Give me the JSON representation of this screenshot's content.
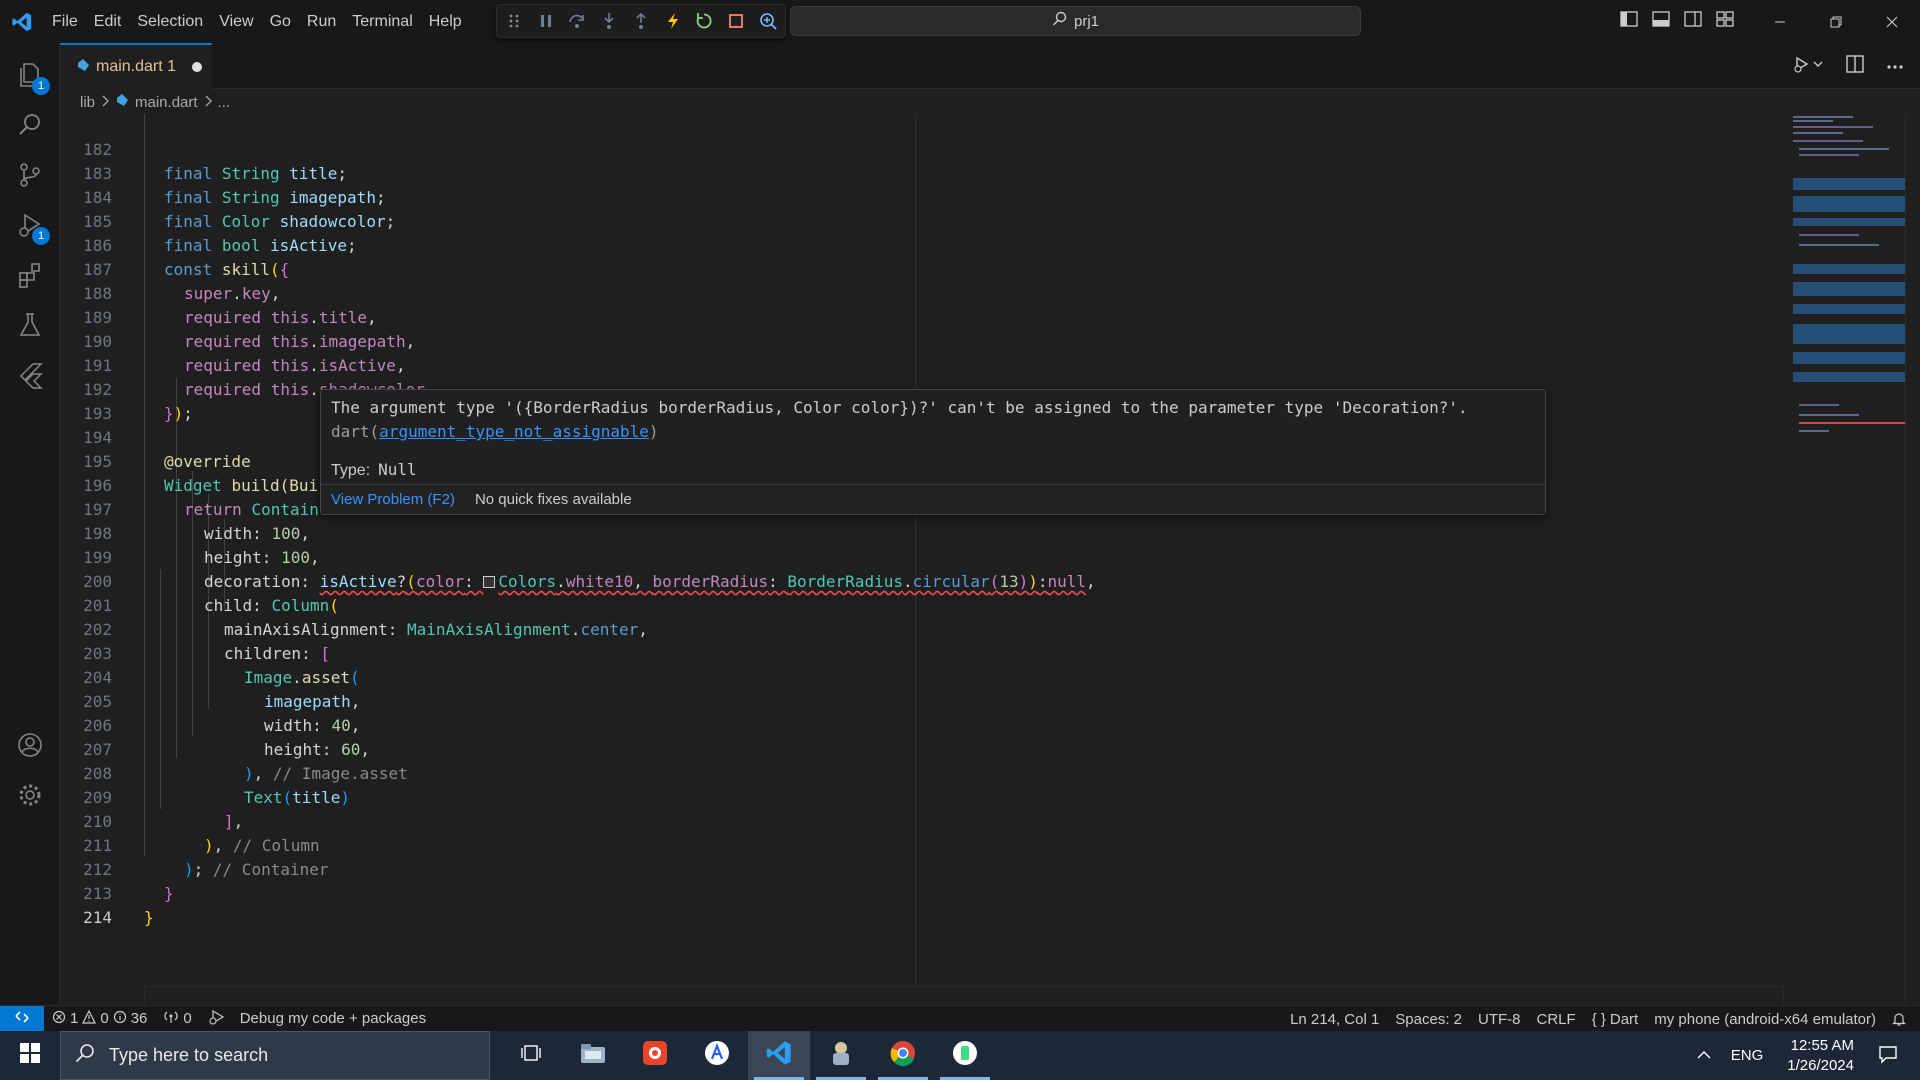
{
  "titlebar": {
    "menu": [
      "File",
      "Edit",
      "Selection",
      "View",
      "Go",
      "Run",
      "Terminal",
      "Help"
    ],
    "command_center": "prj1"
  },
  "activity_bar": {
    "explorer_badge": "1",
    "run_debug_badge": "1"
  },
  "tab": {
    "label": "main.dart 1"
  },
  "breadcrumb": {
    "folder": "lib",
    "file": "main.dart",
    "more": "..."
  },
  "editor": {
    "active_line": "214",
    "lines": [
      {
        "n": "182"
      },
      {
        "n": "183"
      },
      {
        "n": "184"
      },
      {
        "n": "185"
      },
      {
        "n": "186"
      },
      {
        "n": "187"
      },
      {
        "n": "188"
      },
      {
        "n": "189"
      },
      {
        "n": "190"
      },
      {
        "n": "191"
      },
      {
        "n": "192"
      },
      {
        "n": "193"
      },
      {
        "n": "194"
      },
      {
        "n": "195"
      },
      {
        "n": "196"
      },
      {
        "n": "197"
      },
      {
        "n": "198"
      },
      {
        "n": "199"
      },
      {
        "n": "200"
      },
      {
        "n": "201"
      },
      {
        "n": "202"
      },
      {
        "n": "203"
      },
      {
        "n": "204"
      },
      {
        "n": "205"
      },
      {
        "n": "206"
      },
      {
        "n": "207"
      },
      {
        "n": "208"
      },
      {
        "n": "209"
      },
      {
        "n": "210"
      },
      {
        "n": "211"
      },
      {
        "n": "212"
      },
      {
        "n": "213"
      },
      {
        "n": "214"
      }
    ],
    "tokens": {
      "final": "final",
      "String": "String",
      "Color": "Color",
      "bool": "bool",
      "const": "const",
      "title": "title",
      "imagepath": "imagepath",
      "shadowcolor": "shadowcolor",
      "isActive": "isActive",
      "skill": "skill",
      "super": "super",
      "key": "key",
      "required": "required",
      "this": "this",
      "override": "@override",
      "Widget": "Widget",
      "build_partial": "build(Bui",
      "return": "return",
      "Contain": "Contain",
      "width": "width",
      "height": "height",
      "decoration": "decoration",
      "color": "color",
      "Colors": "Colors",
      "white10": "white10",
      "borderRadius": "borderRadius",
      "BorderRadius": "BorderRadius",
      "circular": "circular",
      "null": "null",
      "child": "child",
      "Column": "Column",
      "mainAxisAlignment": "mainAxisAlignment",
      "MainAxisAlignment": "MainAxisAlignment",
      "center": "center",
      "children": "children",
      "Image": "Image",
      "asset": "asset",
      "Text": "Text",
      "n100": "100",
      "n13": "13",
      "n40": "40",
      "n60": "60",
      "c_image_asset": "// Image.asset",
      "c_column": "// Column",
      "c_container": "// Container"
    }
  },
  "hover": {
    "message": "The argument type '({BorderRadius borderRadius, Color color})?' can't be assigned to the parameter type 'Decoration?'.",
    "source": "dart",
    "code": "argument_type_not_assignable",
    "type_label": "Type:",
    "type_value": "Null",
    "action": "View Problem (F2)",
    "no_fix": "No quick fixes available"
  },
  "statusbar": {
    "errors": "1",
    "warnings": "0",
    "infos": "36",
    "ports": "0",
    "debug": "Debug my code + packages",
    "position": "Ln 214, Col 1",
    "spaces": "Spaces: 2",
    "encoding": "UTF-8",
    "eol": "CRLF",
    "language": "Dart",
    "device": "my phone (android-x64 emulator)"
  },
  "taskbar": {
    "search_placeholder": "Type here to search",
    "lang": "ENG",
    "time": "12:55 AM",
    "date": "1/26/2024"
  },
  "colors": {
    "accent": "#0078d4",
    "error": "#f14c4c",
    "keyword": "#569cd6",
    "control": "#c586c0",
    "type": "#4ec9b0"
  }
}
